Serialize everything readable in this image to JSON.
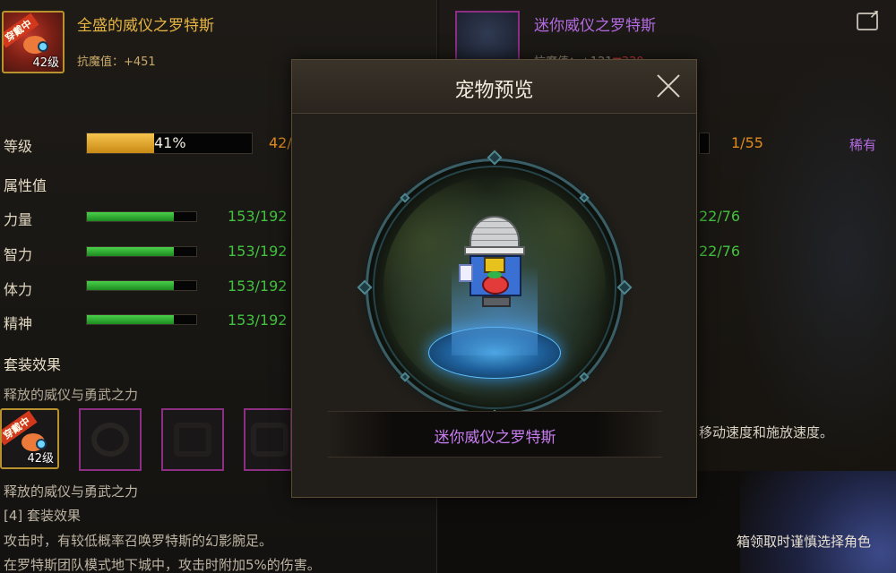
{
  "left": {
    "pet_name": "全盛的威仪之罗特斯",
    "wear_tag": "穿戴中",
    "pet_level": "42级",
    "resist_label": "抗魔值：+451",
    "level_row": {
      "label": "等级",
      "bar_text": "41%",
      "progress": 0.41,
      "num": "42/"
    },
    "attributes_title": "属性值",
    "stats": [
      {
        "label": "力量",
        "value": "153/192",
        "progress": 0.797
      },
      {
        "label": "智力",
        "value": "153/192",
        "progress": 0.797
      },
      {
        "label": "体力",
        "value": "153/192",
        "progress": 0.797
      },
      {
        "label": "精神",
        "value": "153/192",
        "progress": 0.797
      }
    ],
    "set_title": "套装效果",
    "set_name": "释放的威仪与勇武之力",
    "set_slot_level": "42级",
    "desc_lines": [
      "释放的威仪与勇武之力",
      "[4] 套装效果",
      "攻击时，有较低概率召唤罗特斯的幻影腕足。",
      "在罗特斯团队模式地下城中，攻击时附加5%的伤害。"
    ]
  },
  "right": {
    "pet_name": "迷你威仪之罗特斯",
    "resist_label": "抗魔值：+121",
    "resist_diff": "▼330",
    "level_num": "1/55",
    "rarity": "稀有",
    "stat_values": [
      "22/76",
      "22/76"
    ],
    "speed_text": "、移动速度和施放速度。",
    "bottom_text": "箱领取时谨慎选择角色"
  },
  "modal": {
    "title": "宠物预览",
    "pet_name": "迷你威仪之罗特斯"
  },
  "icons": {
    "close": "close-icon",
    "share": "share-icon"
  },
  "colors": {
    "gold": "#e6b443",
    "purple_rare": "#b36ae0",
    "green_value": "#42c23f",
    "orange_value": "#e08b1e"
  }
}
